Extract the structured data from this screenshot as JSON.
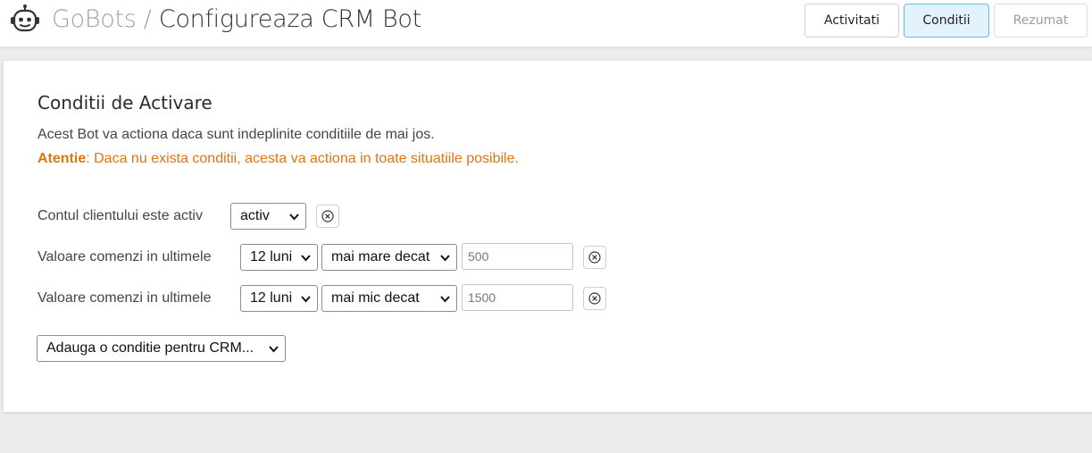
{
  "header": {
    "brand": "GoBots",
    "separator": "/",
    "page_title": "Configureaza CRM Bot",
    "tabs": [
      {
        "label": "Activitati",
        "state": "default"
      },
      {
        "label": "Conditii",
        "state": "active"
      },
      {
        "label": "Rezumat",
        "state": "disabled"
      }
    ]
  },
  "section": {
    "title": "Conditii de Activare",
    "description": "Acest Bot va actiona daca sunt indeplinite conditiile de mai jos.",
    "warning_label": "Atentie",
    "warning_text": ": Daca nu exista conditii, acesta va actiona in toate situatiile posibile."
  },
  "conditions": [
    {
      "label": "Contul clientului este activ",
      "status": "activ",
      "remove_icon": "remove-circle-icon"
    },
    {
      "label": "Valoare comenzi in ultimele",
      "period": "12 luni",
      "operator": "mai mare decat",
      "value": "500",
      "remove_icon": "remove-circle-icon"
    },
    {
      "label": "Valoare comenzi in ultimele",
      "period": "12 luni",
      "operator": "mai mic decat",
      "value": "1500",
      "remove_icon": "remove-circle-icon"
    }
  ],
  "add_condition": {
    "label": "Adauga o conditie pentru CRM..."
  },
  "icons": {
    "logo": "robot-icon",
    "dropdown": "chevron-down-icon",
    "remove": "remove-circle-icon"
  },
  "colors": {
    "active_tab_bg": "#e3f3fd",
    "active_tab_border": "#6cb7e6",
    "warning": "#e07410",
    "page_bg": "#ececec"
  }
}
